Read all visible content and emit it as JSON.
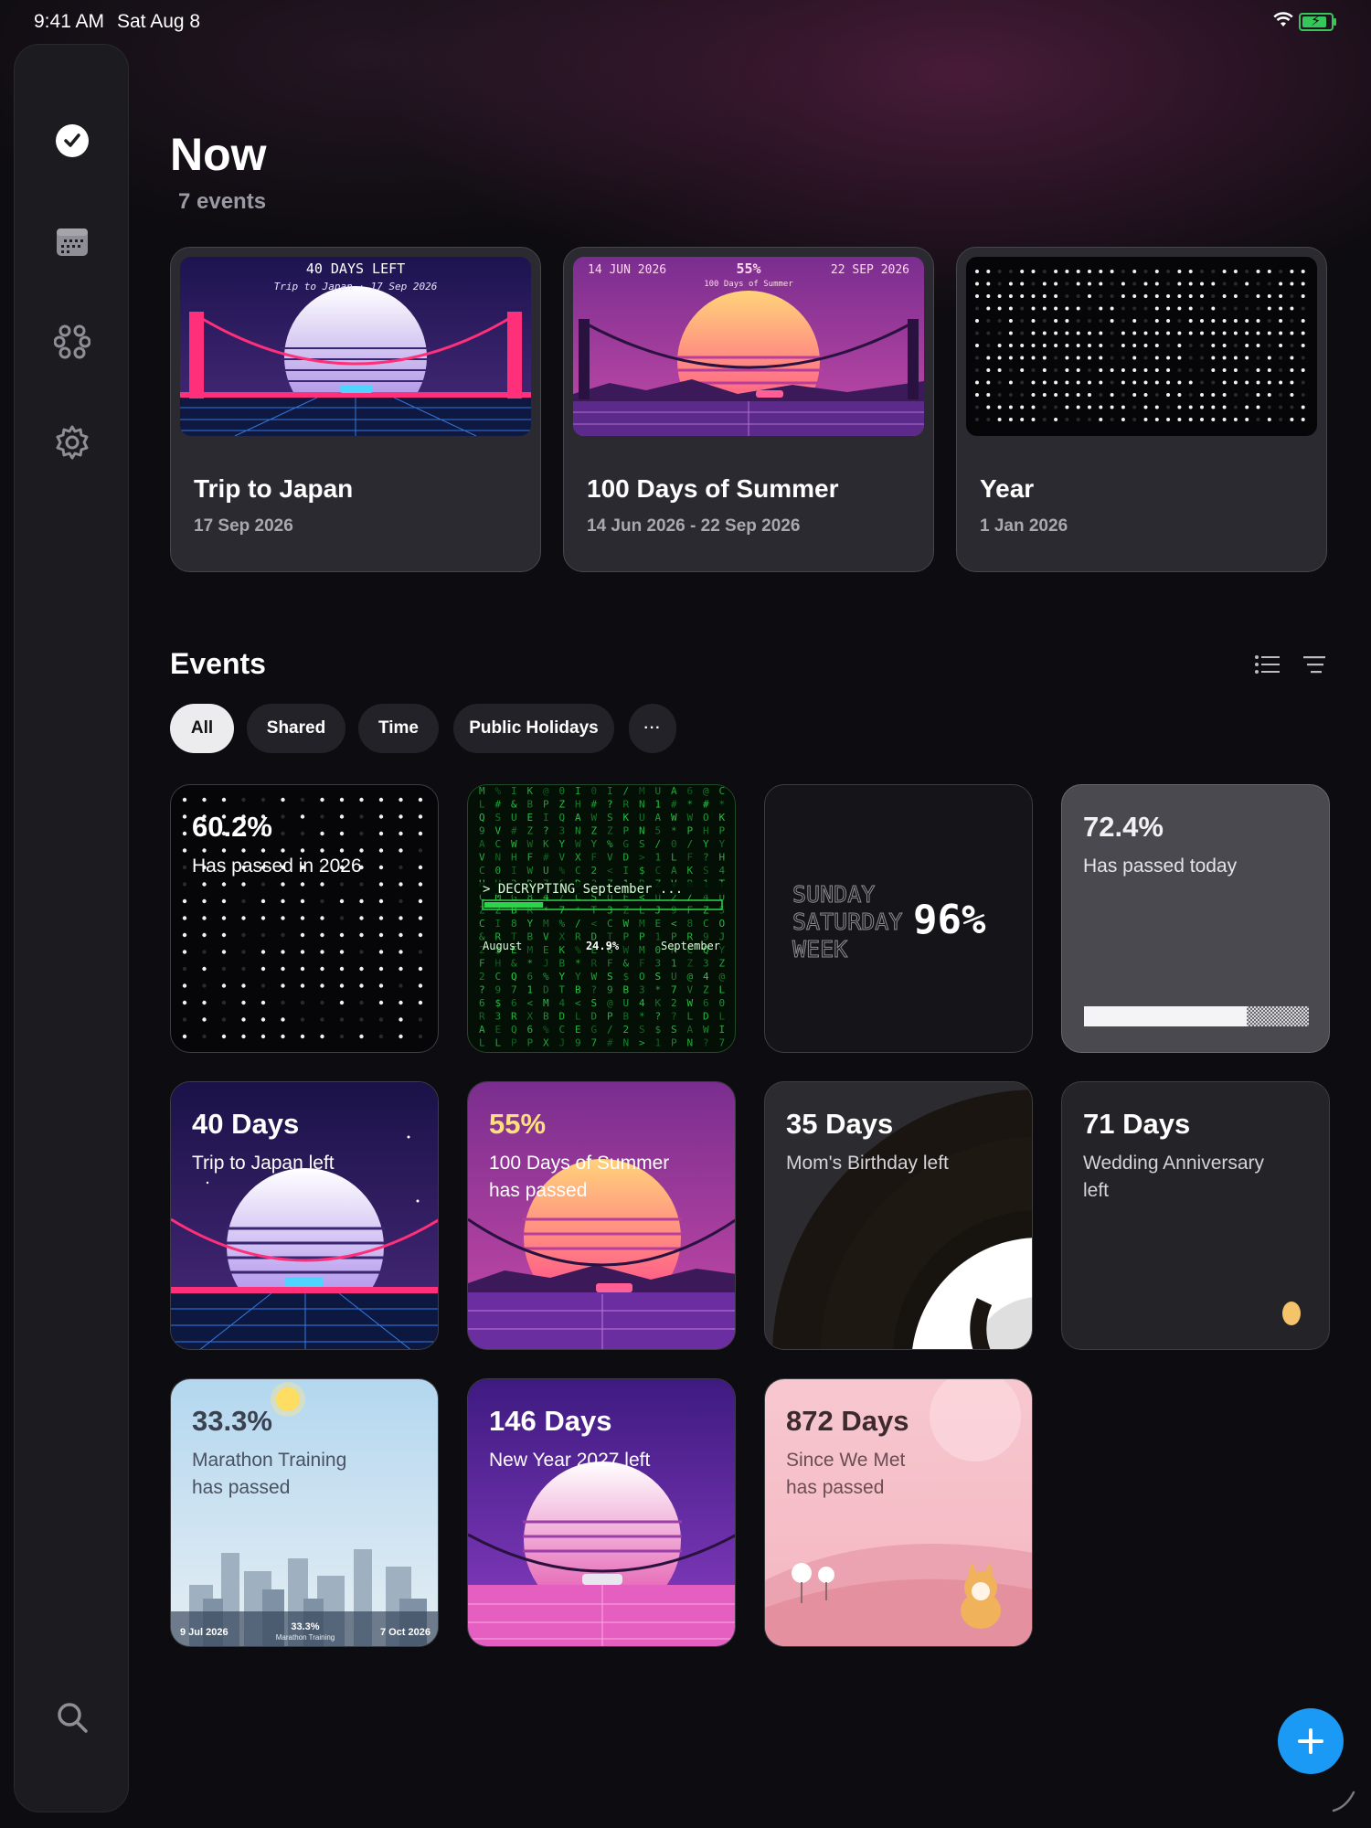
{
  "status": {
    "time": "9:41 AM",
    "date": "Sat Aug 8"
  },
  "header": {
    "title": "Now",
    "subtitle": "7 events"
  },
  "now_cards": [
    {
      "title": "Trip to Japan",
      "date": "17 Sep 2026",
      "badge": "40 DAYS LEFT",
      "caption": "Trip to Japan · 17 Sep 2026"
    },
    {
      "title": "100 Days of Summer",
      "date": "14 Jun 2026 - 22 Sep 2026",
      "start": "14 JUN 2026",
      "percent": "55%",
      "end": "22 SEP 2026",
      "caption": "100 Days of Summer"
    },
    {
      "title": "Year",
      "date": "1 Jan 2026"
    }
  ],
  "events": {
    "title": "Events",
    "filters": [
      "All",
      "Shared",
      "Time",
      "Public Holidays"
    ],
    "more_label": "···"
  },
  "tiles": {
    "year": {
      "value": "60.2%",
      "label": "Has passed in 2026"
    },
    "decrypt": {
      "line": "> DECRYPTING September ...",
      "left": "August",
      "center": "24.9%",
      "right": "September",
      "progress": 0.249
    },
    "week": {
      "line1": "SUNDAY",
      "line2": "SATURDAY",
      "line3": "WEEK",
      "value": "96%"
    },
    "today": {
      "value": "72.4%",
      "label": "Has passed today",
      "progress": 0.724
    },
    "japan": {
      "value": "40 Days",
      "label": "Trip to Japan left"
    },
    "summer": {
      "value": "55%",
      "label1": "100 Days of Summer",
      "label2": "has passed"
    },
    "mom": {
      "value": "35 Days",
      "label": "Mom's Birthday left"
    },
    "wedding": {
      "value": "71 Days",
      "label1": "Wedding Anniversary",
      "label2": "left"
    },
    "marathon": {
      "value": "33.3%",
      "label1": "Marathon Training",
      "label2": "has passed",
      "start": "9 Jul 2026",
      "center": "33.3%",
      "center_sub": "Marathon Training",
      "end": "7 Oct 2026"
    },
    "newyear": {
      "value": "146 Days",
      "label": "New Year 2027 left"
    },
    "met": {
      "value": "872 Days",
      "label1": "Since We Met",
      "label2": "has passed"
    }
  },
  "colors": {
    "accent": "#1b9af5",
    "battery": "#35c759",
    "matrix": "#2bd44a"
  }
}
